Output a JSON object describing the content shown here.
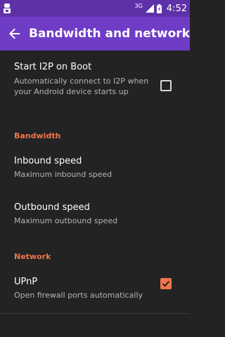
{
  "status_bar": {
    "network_type": "3G",
    "time": "4:52",
    "icons": [
      "notification-icon",
      "signal-icon",
      "battery-icon"
    ]
  },
  "app_bar": {
    "title": "Bandwidth and network",
    "back_icon": "arrow-back-icon"
  },
  "colors": {
    "status_bar": "#5e31a8",
    "app_bar": "#6f3cc6",
    "background": "#232323",
    "accent": "#f0744a",
    "summary_text": "#b4b4b4"
  },
  "preferences": {
    "start_on_boot": {
      "title": "Start I2P on Boot",
      "summary": "Automatically connect to I2P when your Android device starts up",
      "checked": false
    },
    "bandwidth": {
      "category": "Bandwidth",
      "inbound": {
        "title": "Inbound speed",
        "summary": "Maximum inbound speed"
      },
      "outbound": {
        "title": "Outbound speed",
        "summary": "Maximum outbound speed"
      }
    },
    "network": {
      "category": "Network",
      "upnp": {
        "title": "UPnP",
        "summary": "Open firewall ports automatically",
        "checked": true
      }
    }
  }
}
